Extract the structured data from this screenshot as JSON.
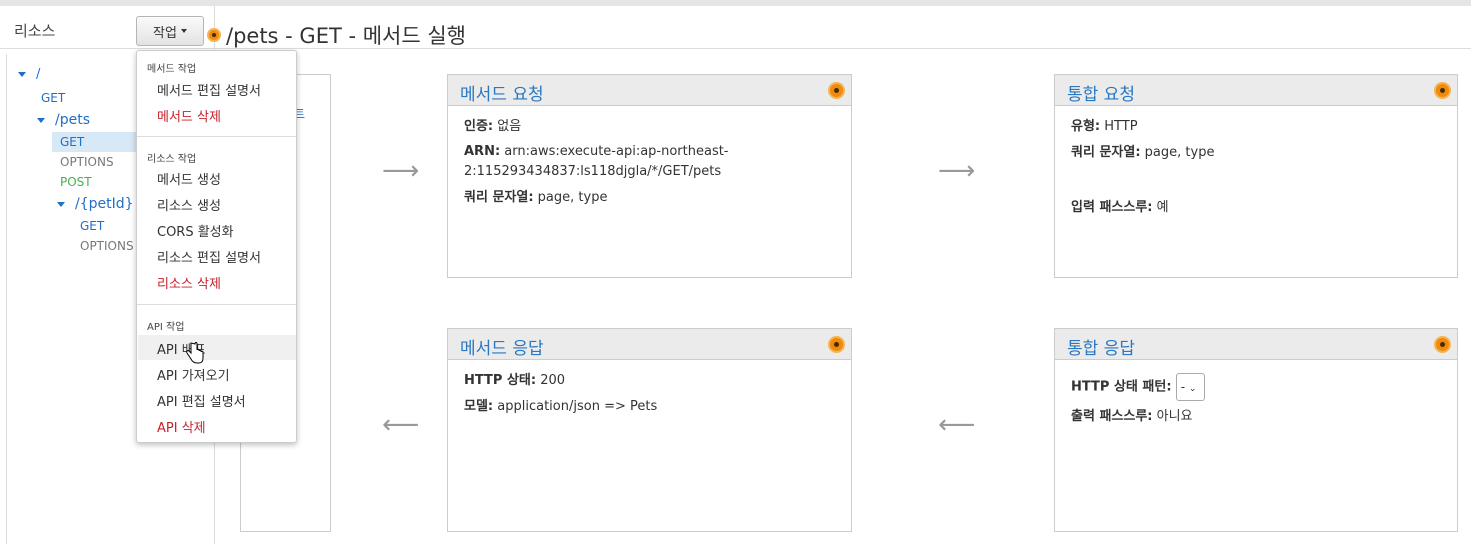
{
  "sidebar": {
    "title": "리소스",
    "tree": [
      {
        "label": "/"
      },
      {
        "label": "GET"
      },
      {
        "label": "/pets"
      },
      {
        "label": "GET"
      },
      {
        "label": "OPTIONS"
      },
      {
        "label": "POST"
      },
      {
        "label": "/{petId}"
      },
      {
        "label": "GET"
      },
      {
        "label": "OPTIONS"
      }
    ]
  },
  "toolbar": {
    "actions_label": "작업"
  },
  "page": {
    "title": "/pets - GET - 메서드 실행"
  },
  "menu": {
    "section1": "메서드 작업",
    "items1": [
      "메서드 편집 설명서",
      "메서드 삭제"
    ],
    "section2": "리소스 작업",
    "items2": [
      "메서드 생성",
      "리소스 생성",
      "CORS 활성화",
      "리소스 편집 설명서",
      "리소스 삭제"
    ],
    "section3": "API 작업",
    "items3": [
      "API 배포",
      "API 가져오기",
      "API 편집 설명서",
      "API 삭제"
    ]
  },
  "partial_left_text": "트",
  "method_request": {
    "title": "메서드 요청",
    "auth_label": "인증:",
    "auth_value": "없음",
    "arn_label": "ARN:",
    "arn_value_line1": "arn:aws:execute-api:ap-northeast-",
    "arn_value_line2": "2:115293434837:ls118djgla/*/GET/pets",
    "query_label": "쿼리 문자열:",
    "query_value": "page, type"
  },
  "integration_request": {
    "title": "통합 요청",
    "type_label": "유형:",
    "type_value": "HTTP",
    "query_label": "쿼리 문자열:",
    "query_value": "page, type",
    "passthrough_label": "입력 패스스루:",
    "passthrough_value": "예"
  },
  "method_response": {
    "title": "메서드 응답",
    "status_label": "HTTP 상태:",
    "status_value": "200",
    "model_label": "모델:",
    "model_value": "application/json => Pets"
  },
  "integration_response": {
    "title": "통합 응답",
    "pattern_label": "HTTP 상태 패턴:",
    "pattern_value": "-",
    "passthrough_label": "출력 패스스루:",
    "passthrough_value": "아니요"
  },
  "colors": {
    "accent": "#1f6ec8",
    "delete": "#c7212a",
    "post": "#44b04b",
    "status_dot": "#f08a0c"
  }
}
